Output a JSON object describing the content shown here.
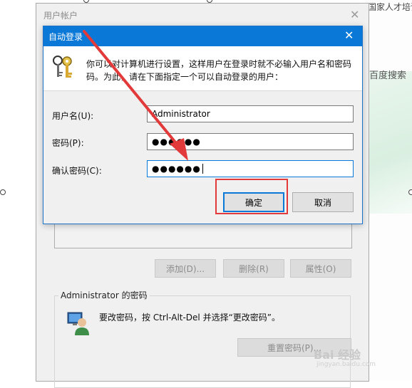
{
  "background": {
    "right_top_text": "国家人才培训网",
    "right_side_text": "百度搜索"
  },
  "parent_window": {
    "title": "用户帐户",
    "close_glyph": "✕",
    "buttons": {
      "add": "添加(D)...",
      "remove": "删除(R)",
      "properties": "属性(O)"
    },
    "password_group": {
      "label": "Administrator 的密码",
      "instruction": "要改密码，按 Ctrl-Alt-Del 并选择“更改密码”。",
      "reset_button": "重置密码(P)..."
    }
  },
  "dialog": {
    "title": "自动登录",
    "close_glyph": "✕",
    "intro_line1": "你可以对计算机进行设置，这样用户在登录时就不必输入用户名和密码",
    "intro_line2": "码。为此，请在下面指定一个可以自动登录的用户：",
    "fields": {
      "username_label": "用户名(U):",
      "username_value": "Administrator",
      "password_label": "密码(P):",
      "password_value": "●●●●●●",
      "confirm_label": "确认密码(C):",
      "confirm_value": "●●●●●●"
    },
    "ok_label": "确定",
    "cancel_label": "取消"
  },
  "watermark": {
    "text": "Bai 经验",
    "sub": "jingyan.baidu.com"
  },
  "colors": {
    "accent": "#0a78d7",
    "annotation_red": "#e23a3a"
  }
}
